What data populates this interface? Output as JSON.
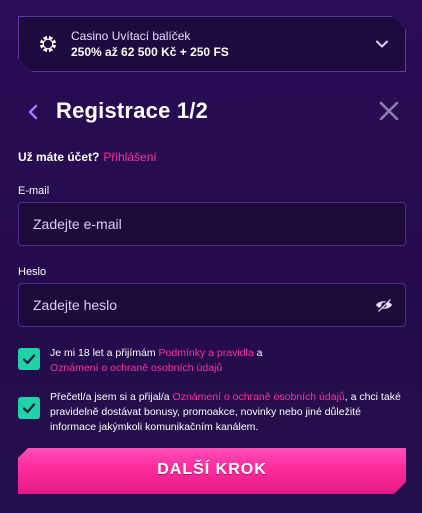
{
  "bonus": {
    "title": "Casino Uvítací balíček",
    "value": "250% až 62 500 Kč + 250 FS",
    "icon": "poker-chip-icon"
  },
  "registration": {
    "title": "Registrace 1/2"
  },
  "account": {
    "question": "Už máte účet?",
    "login_link": "Přihlášení"
  },
  "email": {
    "label": "E-mail",
    "placeholder": "Zadejte e-mail"
  },
  "password": {
    "label": "Heslo",
    "placeholder": "Zadejte heslo"
  },
  "consent1": {
    "text_a": "Je mi 18 let a přijímám ",
    "link_a": "Podmínky a pravidla",
    "text_b": " a ",
    "link_b": "Oznámení o ochraně osobních údajů",
    "checked": true
  },
  "consent2": {
    "text_a": "Přečetl/a jsem si a přijal/a ",
    "link_a": "Oznámení o ochraně osobních údajů",
    "text_b": ", a chci také pravidelně dostávat bonusy, promoakce, novinky nebo jiné důležité informace jakýmkoli komunikačním kanálem.",
    "checked": true
  },
  "next_button": {
    "label": "DALŠÍ KROK"
  },
  "colors": {
    "accent": "#ff2e9b",
    "checkbox": "#1fd2a8",
    "background": "#2a0d55"
  }
}
